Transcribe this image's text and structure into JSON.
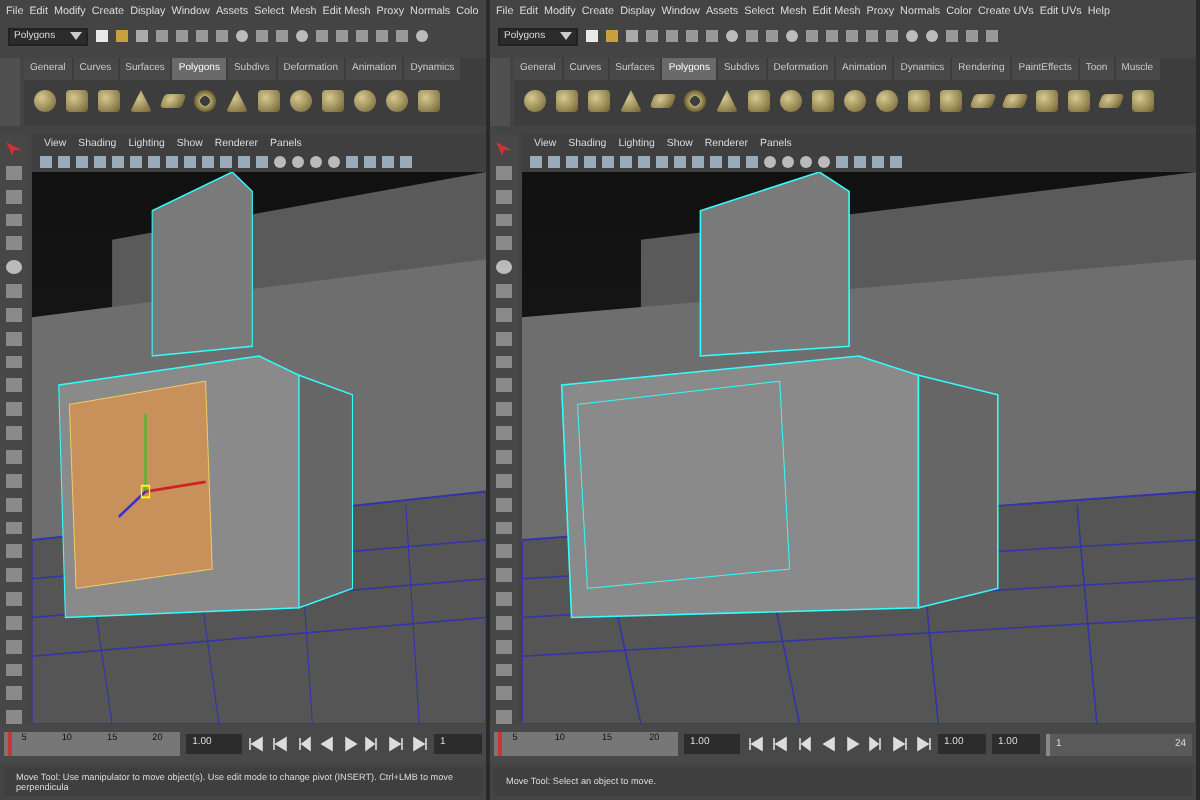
{
  "windows": [
    {
      "menu": [
        "File",
        "Edit",
        "Modify",
        "Create",
        "Display",
        "Window",
        "Assets",
        "Select",
        "Mesh",
        "Edit Mesh",
        "Proxy",
        "Normals",
        "Colo"
      ],
      "mode": "Polygons",
      "shelf_tabs": [
        {
          "label": "General",
          "selected": false
        },
        {
          "label": "Curves",
          "selected": false
        },
        {
          "label": "Surfaces",
          "selected": false
        },
        {
          "label": "Polygons",
          "selected": true
        },
        {
          "label": "Subdivs",
          "selected": false
        },
        {
          "label": "Deformation",
          "selected": false
        },
        {
          "label": "Animation",
          "selected": false
        },
        {
          "label": "Dynamics",
          "selected": false
        }
      ],
      "panel_menu": [
        "View",
        "Shading",
        "Lighting",
        "Show",
        "Renderer",
        "Panels"
      ],
      "face_selected": true,
      "time_slider": {
        "ticks": [
          "5",
          "10",
          "15",
          "20"
        ],
        "level": 0.02
      },
      "current_frame": "1.00",
      "range_fields": [
        "1"
      ],
      "help": "Move Tool: Use manipulator to move object(s). Use edit mode to change pivot (INSERT).  Ctrl+LMB to move perpendicula"
    },
    {
      "menu": [
        "File",
        "Edit",
        "Modify",
        "Create",
        "Display",
        "Window",
        "Assets",
        "Select",
        "Mesh",
        "Edit Mesh",
        "Proxy",
        "Normals",
        "Color",
        "Create UVs",
        "Edit UVs",
        "Help"
      ],
      "mode": "Polygons",
      "shelf_tabs": [
        {
          "label": "General",
          "selected": false
        },
        {
          "label": "Curves",
          "selected": false
        },
        {
          "label": "Surfaces",
          "selected": false
        },
        {
          "label": "Polygons",
          "selected": true
        },
        {
          "label": "Subdivs",
          "selected": false
        },
        {
          "label": "Deformation",
          "selected": false
        },
        {
          "label": "Animation",
          "selected": false
        },
        {
          "label": "Dynamics",
          "selected": false
        },
        {
          "label": "Rendering",
          "selected": false
        },
        {
          "label": "PaintEffects",
          "selected": false
        },
        {
          "label": "Toon",
          "selected": false
        },
        {
          "label": "Muscle",
          "selected": false
        }
      ],
      "panel_menu": [
        "View",
        "Shading",
        "Lighting",
        "Show",
        "Renderer",
        "Panels"
      ],
      "face_selected": false,
      "time_slider": {
        "ticks": [
          "5",
          "10",
          "15",
          "20"
        ],
        "level": 0.02
      },
      "current_frame": "1.00",
      "range_fields": [
        "1.00",
        "1.00"
      ],
      "range_slider": {
        "start": "1",
        "end": "24",
        "level": 1
      },
      "help": "Move Tool: Select an object to move."
    }
  ]
}
